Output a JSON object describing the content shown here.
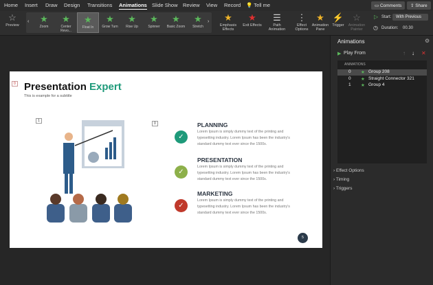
{
  "tabs": [
    "Home",
    "Insert",
    "Draw",
    "Design",
    "Transitions",
    "Animations",
    "Slide Show",
    "Review",
    "View",
    "Record",
    "Tell me"
  ],
  "active_tab": "Animations",
  "ribbon": {
    "preview": "Preview",
    "gallery": [
      "Zoom",
      "Center Revo...",
      "Float In",
      "Grow Turn",
      "Rise Up",
      "Spinner",
      "Basic Zoom",
      "Stretch"
    ],
    "selected_effect": "Float In",
    "emphasis": "Emphasis Effects",
    "exit": "Exit Effects",
    "path": "Path Animation",
    "effect_options": "Effect Options",
    "pane": "Animation Pane",
    "trigger": "Trigger",
    "painter": "Animation Painter",
    "start_label": "Start:",
    "start_value": "With Previous",
    "duration_label": "Duration:",
    "duration_value": "00.30",
    "comments": "Comments",
    "share": "Share"
  },
  "slide": {
    "title_black": "Presentation",
    "title_green": "Expert",
    "subtitle": "This is example  for a subtitle",
    "tags": [
      "0",
      "1",
      "0"
    ],
    "items": [
      {
        "heading": "PLANNING",
        "text": "Lorem Ipsum is simply dummy text of the printing and typesetting industry. Lorem Ipsum has been the industry's standard dummy text ever since the 1500s.",
        "color": "#1e9a7a"
      },
      {
        "heading": "PRESENTATION",
        "text": "Lorem Ipsum is simply dummy text of the printing and typesetting industry. Lorem Ipsum has been the industry's standard dummy text ever since the 1500s.",
        "color": "#8db04a"
      },
      {
        "heading": "MARKETING",
        "text": "Lorem Ipsum is simply dummy text of the printing and typesetting industry. Lorem Ipsum has been the industry's standard dummy text ever since the 1500s.",
        "color": "#c0392b"
      }
    ],
    "page_number": "5"
  },
  "panel": {
    "title": "Animations",
    "play_from": "Play From",
    "list_header": "ANIMATIONS",
    "rows": [
      {
        "n": "0",
        "name": "Group 208"
      },
      {
        "n": "0",
        "name": "Straight Connector 321"
      },
      {
        "n": "1",
        "name": "Group 4"
      }
    ],
    "sections": [
      "Effect Options",
      "Timing",
      "Triggers"
    ]
  }
}
